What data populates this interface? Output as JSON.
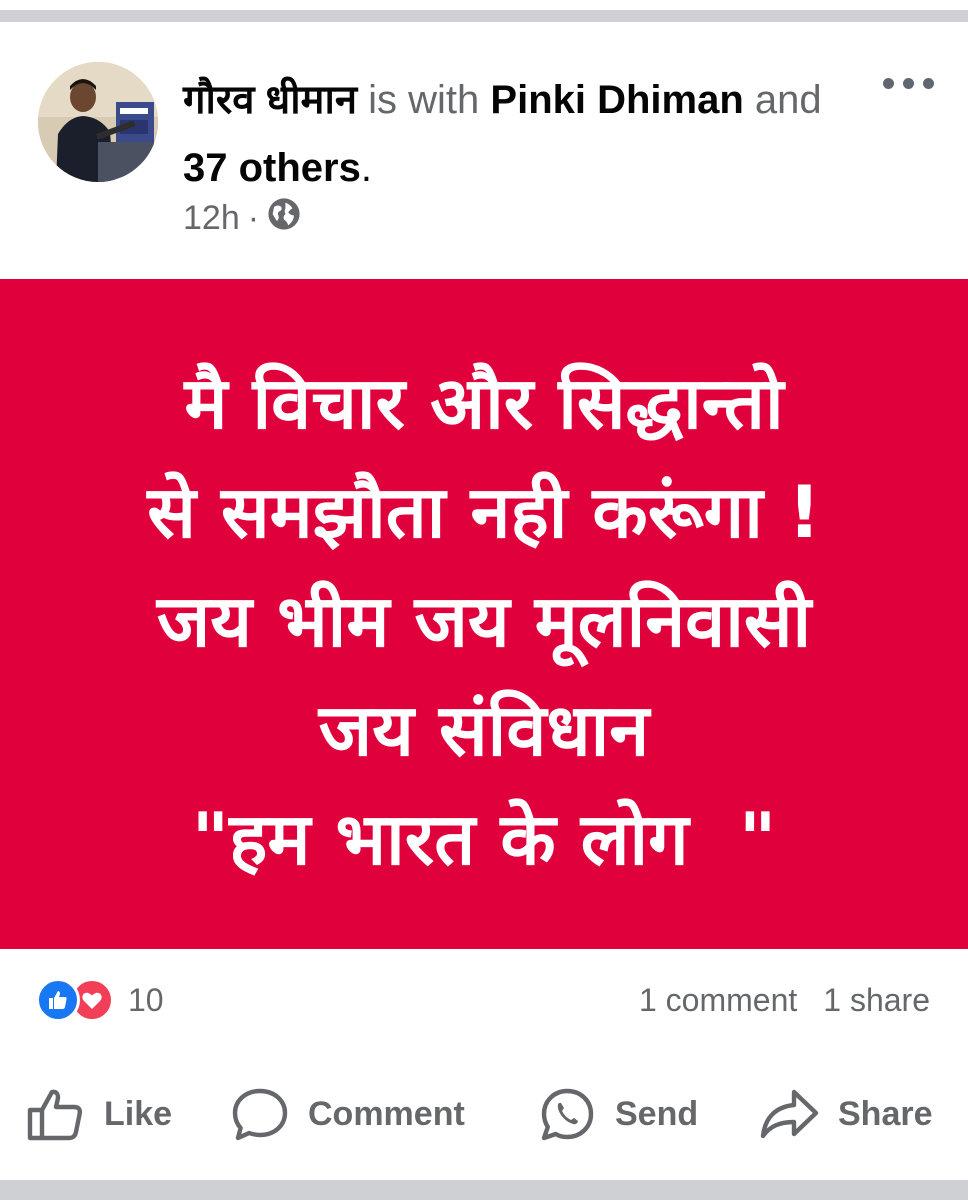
{
  "post": {
    "author": "गौरव धीमान",
    "with_text": " is with ",
    "tagged_person": "Pinki Dhiman",
    "and_text": " and ",
    "others_text": "37 others",
    "period": ".",
    "time": "12h",
    "separator": "·",
    "audience_icon": "globe-icon",
    "more_icon": "more-options-icon"
  },
  "image": {
    "background": "#e0003c",
    "lines": [
      "मै विचार और सिद्धान्तो",
      "से समझौता नही करूंगा !",
      "जय भीम जय मूलनिवासी",
      "जय संविधान",
      "\"हम भारत के लोग  \""
    ]
  },
  "stats": {
    "reaction_count": "10",
    "comments": "1 comment",
    "shares": "1 share",
    "reaction_icons": [
      "like-reaction-icon",
      "love-reaction-icon"
    ]
  },
  "actions": {
    "like": "Like",
    "comment": "Comment",
    "send": "Send",
    "share": "Share"
  },
  "colors": {
    "accent_blue": "#1877f2",
    "love_red": "#f33e58",
    "text_secondary": "#65676b"
  }
}
